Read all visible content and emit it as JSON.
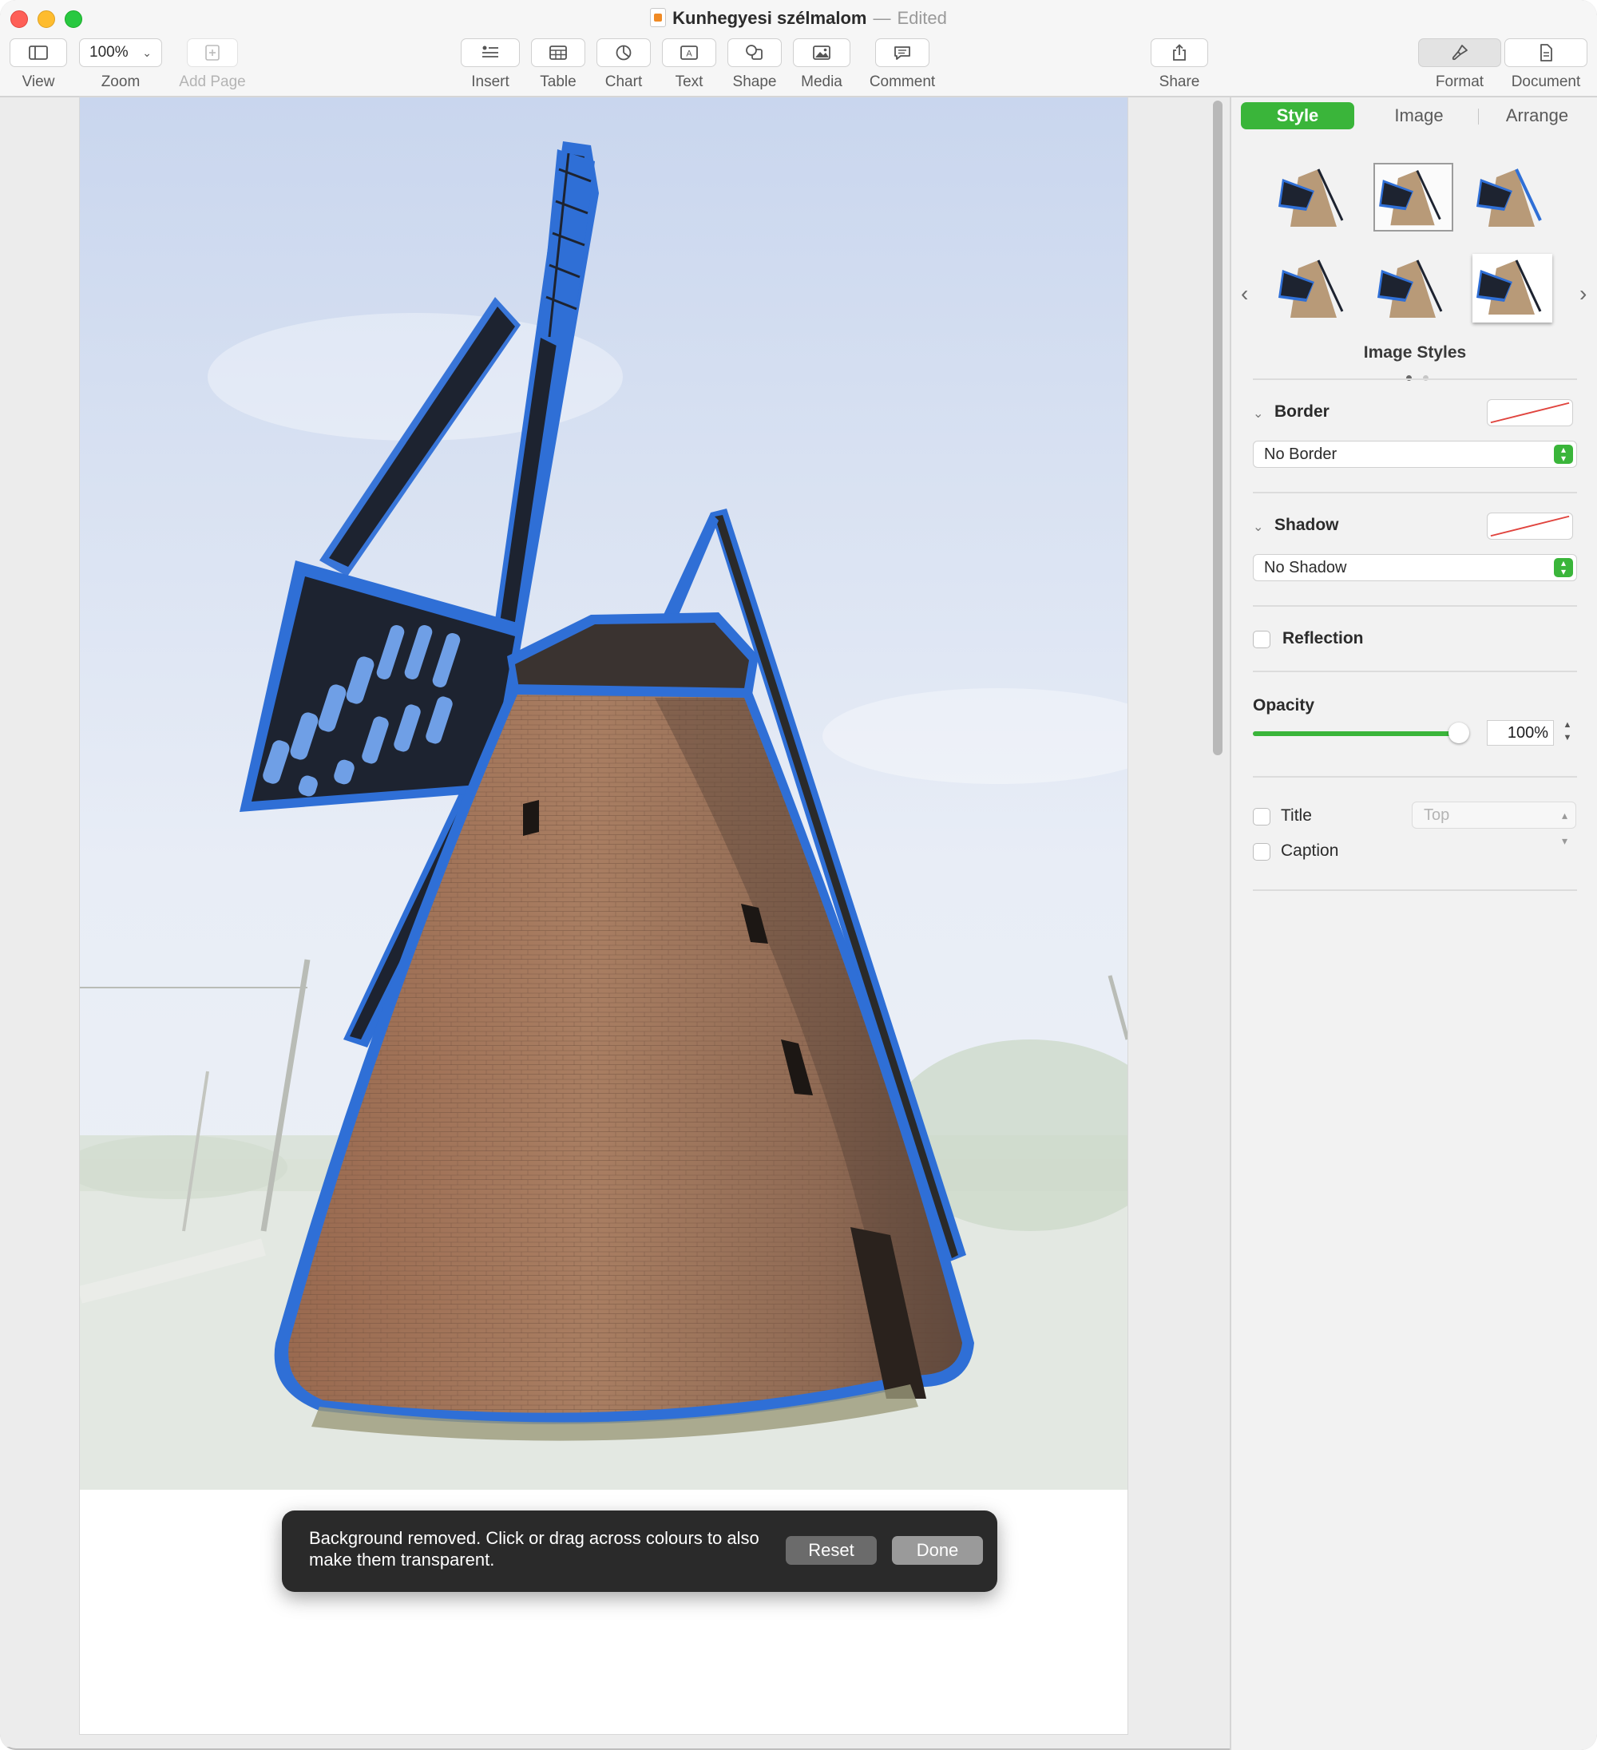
{
  "window": {
    "title": "Kunhegyesi szélmalom",
    "status": "Edited",
    "separator": "—"
  },
  "toolbar": {
    "view": "View",
    "zoom_value": "100%",
    "zoom": "Zoom",
    "add_page": "Add Page",
    "insert": "Insert",
    "table": "Table",
    "chart": "Chart",
    "text": "Text",
    "shape": "Shape",
    "media": "Media",
    "comment": "Comment",
    "share": "Share",
    "format": "Format",
    "document": "Document"
  },
  "toast": {
    "message": "Background removed. Click or drag across colours to also make them transparent.",
    "reset": "Reset",
    "done": "Done"
  },
  "inspector": {
    "tabs": [
      "Style",
      "Image",
      "Arrange"
    ],
    "active_tab": "Style",
    "image_styles_label": "Image Styles",
    "border_label": "Border",
    "border_value": "No Border",
    "shadow_label": "Shadow",
    "shadow_value": "No Shadow",
    "reflection_label": "Reflection",
    "opacity_label": "Opacity",
    "opacity_value": "100%",
    "opacity_fraction": 1.0,
    "title_label": "Title",
    "title_position": "Top",
    "caption_label": "Caption"
  },
  "colors": {
    "accent": "#3ab53a",
    "selection_outline": "#2f6fd6",
    "brick": "#8a6c55",
    "sky": "#cfdcef"
  },
  "icons": {
    "view": "sidebar-icon",
    "add_page": "plus-square-icon",
    "insert": "list-insert-icon",
    "table": "table-icon",
    "chart": "pie-chart-icon",
    "text": "text-box-icon",
    "shape": "shape-icon",
    "media": "photo-icon",
    "comment": "speech-bubble-icon",
    "share": "share-icon",
    "format": "paintbrush-icon",
    "document": "document-icon"
  }
}
